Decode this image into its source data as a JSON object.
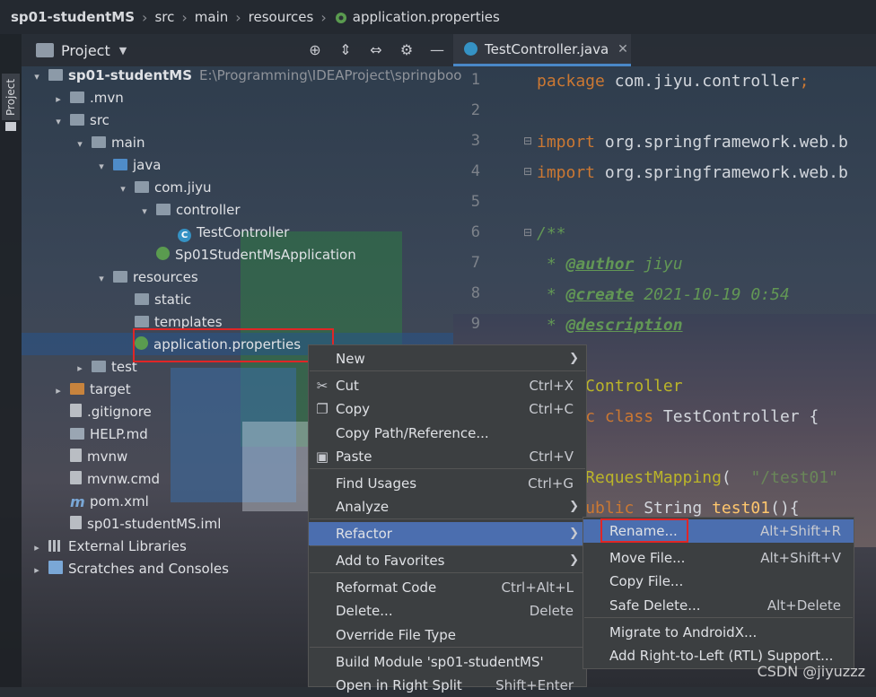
{
  "breadcrumb": {
    "items": [
      "sp01-studentMS",
      "src",
      "main",
      "resources",
      "application.properties"
    ]
  },
  "tool_stripe": {
    "label": "Project"
  },
  "project_panel": {
    "title": "Project",
    "tree": [
      {
        "label": "sp01-studentMS",
        "path": "E:\\Programming\\IDEAProject\\springboo",
        "icon": "module-folder-icon",
        "arrow": "▾"
      },
      {
        "label": ".mvn",
        "icon": "folder-icon",
        "arrow": "▸"
      },
      {
        "label": "src",
        "icon": "folder-icon",
        "arrow": "▾"
      },
      {
        "label": "main",
        "icon": "folder-icon",
        "arrow": "▾"
      },
      {
        "label": "java",
        "icon": "source-folder-icon",
        "arrow": "▾"
      },
      {
        "label": "com.jiyu",
        "icon": "package-icon",
        "arrow": "▾"
      },
      {
        "label": "controller",
        "icon": "package-icon",
        "arrow": "▾"
      },
      {
        "label": "TestController",
        "icon": "class-icon",
        "arrow": ""
      },
      {
        "label": "Sp01StudentMsApplication",
        "icon": "spring-boot-class-icon",
        "arrow": ""
      },
      {
        "label": "resources",
        "icon": "resources-folder-icon",
        "arrow": "▾"
      },
      {
        "label": "static",
        "icon": "folder-icon",
        "arrow": ""
      },
      {
        "label": "templates",
        "icon": "folder-icon",
        "arrow": ""
      },
      {
        "label": "application.properties",
        "icon": "properties-file-icon",
        "arrow": ""
      },
      {
        "label": "test",
        "icon": "folder-icon",
        "arrow": "▸"
      },
      {
        "label": "target",
        "icon": "excluded-folder-icon",
        "arrow": "▸"
      },
      {
        "label": ".gitignore",
        "icon": "gitignore-file-icon",
        "arrow": ""
      },
      {
        "label": "HELP.md",
        "icon": "markdown-file-icon",
        "arrow": ""
      },
      {
        "label": "mvnw",
        "icon": "file-icon",
        "arrow": ""
      },
      {
        "label": "mvnw.cmd",
        "icon": "file-icon",
        "arrow": ""
      },
      {
        "label": "pom.xml",
        "icon": "maven-icon",
        "arrow": ""
      },
      {
        "label": "sp01-studentMS.iml",
        "icon": "iml-file-icon",
        "arrow": ""
      },
      {
        "label": "External Libraries",
        "icon": "library-icon",
        "arrow": "▸"
      },
      {
        "label": "Scratches and Consoles",
        "icon": "scratches-icon",
        "arrow": "▸"
      }
    ]
  },
  "editor": {
    "tab": {
      "label": "TestController.java"
    },
    "line_numbers": [
      "1",
      "2",
      "3",
      "4",
      "5",
      "6",
      "7",
      "8",
      "9"
    ],
    "lines": [
      [
        {
          "t": "package ",
          "c": "kw"
        },
        {
          "t": "com.jiyu.controller",
          "c": "pl"
        },
        {
          "t": ";",
          "c": "kw"
        }
      ],
      [],
      [
        {
          "t": "import ",
          "c": "kw"
        },
        {
          "t": "org.springframework.web.b",
          "c": "pl"
        }
      ],
      [
        {
          "t": "import ",
          "c": "kw"
        },
        {
          "t": "org.springframework.web.b",
          "c": "pl"
        }
      ],
      [],
      [
        {
          "t": "/**",
          "c": "cm"
        }
      ],
      [
        {
          "t": " * ",
          "c": "cm"
        },
        {
          "t": "@author",
          "c": "tag"
        },
        {
          "t": " jiyu",
          "c": "cm"
        }
      ],
      [
        {
          "t": " * ",
          "c": "cm"
        },
        {
          "t": "@create",
          "c": "tag"
        },
        {
          "t": " 2021-10-19 0:54",
          "c": "cm"
        }
      ],
      [
        {
          "t": " * ",
          "c": "cm"
        },
        {
          "t": "@description",
          "c": "tag"
        }
      ],
      [],
      [
        {
          "t": "    tController",
          "c": "ann"
        }
      ],
      [
        {
          "t": "    ",
          "c": "pl"
        },
        {
          "t": "ic class ",
          "c": "kw"
        },
        {
          "t": "TestController {",
          "c": "pl"
        }
      ],
      [],
      [
        {
          "t": "    @RequestMapping",
          "c": "ann"
        },
        {
          "t": "(",
          "c": "pl"
        },
        {
          "t": "  ",
          "c": "pl"
        },
        {
          "t": "\"/test01\"",
          "c": "str"
        }
      ],
      [
        {
          "t": "    ",
          "c": "pl"
        },
        {
          "t": "public ",
          "c": "kw"
        },
        {
          "t": "String ",
          "c": "pl"
        },
        {
          "t": "test01",
          "c": "fn"
        },
        {
          "t": "(){",
          "c": "pl"
        }
      ]
    ]
  },
  "context_menu": {
    "items": [
      {
        "label": "New",
        "shortcut": "",
        "submenu": true
      },
      {
        "label": "Cut",
        "shortcut": "Ctrl+X",
        "icon": "scissors-icon"
      },
      {
        "label": "Copy",
        "shortcut": "Ctrl+C",
        "icon": "copy-icon"
      },
      {
        "label": "Copy Path/Reference...",
        "shortcut": ""
      },
      {
        "label": "Paste",
        "shortcut": "Ctrl+V",
        "icon": "paste-icon"
      },
      {
        "label": "Find Usages",
        "shortcut": "Ctrl+G"
      },
      {
        "label": "Analyze",
        "shortcut": "",
        "submenu": true
      },
      {
        "label": "Refactor",
        "shortcut": "",
        "submenu": true,
        "active": true
      },
      {
        "label": "Add to Favorites",
        "shortcut": "",
        "submenu": true
      },
      {
        "label": "Reformat Code",
        "shortcut": "Ctrl+Alt+L"
      },
      {
        "label": "Delete...",
        "shortcut": "Delete"
      },
      {
        "label": "Override File Type",
        "shortcut": ""
      },
      {
        "label": "Build Module 'sp01-studentMS'",
        "shortcut": ""
      },
      {
        "label": "Open in Right Split",
        "shortcut": "Shift+Enter"
      }
    ]
  },
  "refactor_submenu": {
    "items": [
      {
        "label": "Rename...",
        "shortcut": "Alt+Shift+R",
        "active": true
      },
      {
        "label": "Move File...",
        "shortcut": "Alt+Shift+V"
      },
      {
        "label": "Copy File...",
        "shortcut": ""
      },
      {
        "label": "Safe Delete...",
        "shortcut": "Alt+Delete"
      },
      {
        "label": "Migrate to AndroidX...",
        "shortcut": ""
      },
      {
        "label": "Add Right-to-Left (RTL) Support...",
        "shortcut": ""
      }
    ]
  },
  "watermark": "CSDN @jiyuzzz",
  "colors": {
    "accent": "#4b6eaf",
    "highlight_box": "#e02626",
    "keyword": "#cc7832",
    "comment": "#629755"
  }
}
